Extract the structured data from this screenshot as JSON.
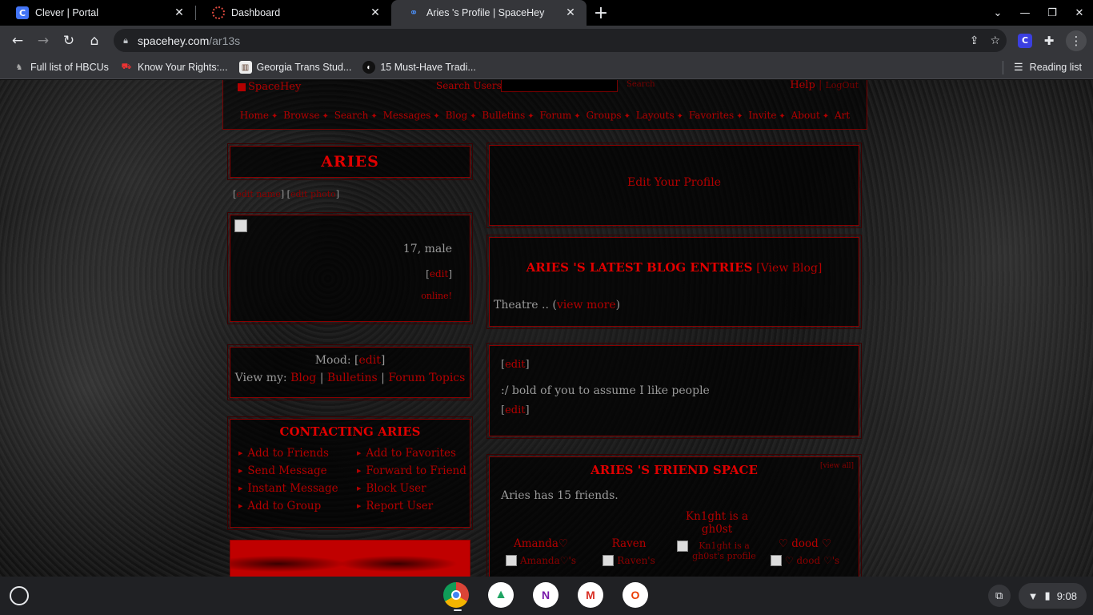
{
  "browser": {
    "tabs": [
      {
        "title": "Clever | Portal",
        "favicon": "clever-icon",
        "active": false
      },
      {
        "title": "Dashboard",
        "favicon": "dashboard-icon",
        "active": false
      },
      {
        "title": "Aries 's Profile | SpaceHey",
        "favicon": "spacehey-icon",
        "active": true
      }
    ],
    "url_host": "spacehey.com",
    "url_path": "/ar13s",
    "bookmarks": [
      {
        "label": "Full list of HBCUs",
        "icon": "hbcu-icon"
      },
      {
        "label": "Know Your Rights:...",
        "icon": "rights-icon"
      },
      {
        "label": "Georgia Trans Stud...",
        "icon": "georgia-icon"
      },
      {
        "label": "15 Must-Have Tradi...",
        "icon": "traditions-icon"
      }
    ],
    "reading_list": "Reading list"
  },
  "header": {
    "logo": "SpaceHey",
    "search_label": "Search Users:",
    "search_button": "Search",
    "help": "Help",
    "logout": "LogOut",
    "nav": [
      "Home",
      "Browse",
      "Search",
      "Messages",
      "Blog",
      "Bulletins",
      "Forum",
      "Groups",
      "Layouts",
      "Favorites",
      "Invite",
      "About",
      "Art"
    ]
  },
  "profile": {
    "name": "ARIES",
    "edit_name": "edit name",
    "edit_photo": "edit photo",
    "age_gender": "17, male",
    "edit": "edit",
    "status": "online!",
    "mood_label": "Mood:",
    "mood_edit": "edit",
    "view_my_label": "View my:",
    "view_my": [
      "Blog",
      "Bulletins",
      "Forum Topics"
    ]
  },
  "contact": {
    "title": "CONTACTING ARIES",
    "items": [
      "Add to Friends",
      "Add to Favorites",
      "Send Message",
      "Forward to Friend",
      "Instant Message",
      "Block User",
      "Add to Group",
      "Report User"
    ]
  },
  "main": {
    "edit_profile": "Edit Your Profile",
    "blog_title": "ARIES 'S LATEST BLOG ENTRIES",
    "view_blog": "View Blog",
    "blog_entry": "Theatre ..",
    "view_more": "view more",
    "about_edit": "edit",
    "about_text": ":/ bold of you to assume I like people",
    "about_edit2": "edit",
    "friend_space_title": "ARIES 'S FRIEND SPACE",
    "view_all": "[view all]",
    "friend_count": "Aries has 15 friends.",
    "friends": [
      {
        "name": "Amanda♡",
        "img_alt": "Amanda♡'s"
      },
      {
        "name": "Raven",
        "img_alt": "Raven's"
      },
      {
        "name": "Kn1ght is a gh0st",
        "img_alt": "Kn1ght is a gh0st's profile"
      },
      {
        "name": "♡ dood ♡",
        "img_alt": "♡ dood ♡'s"
      }
    ]
  },
  "shelf": {
    "apps": [
      "chrome-icon",
      "drive-icon",
      "onenote-icon",
      "gmail-icon",
      "office-icon"
    ],
    "time": "9:08"
  }
}
